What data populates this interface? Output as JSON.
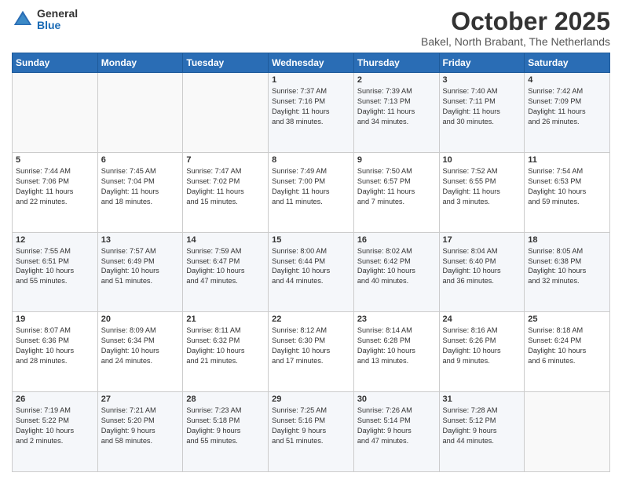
{
  "header": {
    "logo_general": "General",
    "logo_blue": "Blue",
    "month": "October 2025",
    "location": "Bakel, North Brabant, The Netherlands"
  },
  "days_of_week": [
    "Sunday",
    "Monday",
    "Tuesday",
    "Wednesday",
    "Thursday",
    "Friday",
    "Saturday"
  ],
  "weeks": [
    [
      {
        "day": "",
        "info": ""
      },
      {
        "day": "",
        "info": ""
      },
      {
        "day": "",
        "info": ""
      },
      {
        "day": "1",
        "info": "Sunrise: 7:37 AM\nSunset: 7:16 PM\nDaylight: 11 hours\nand 38 minutes."
      },
      {
        "day": "2",
        "info": "Sunrise: 7:39 AM\nSunset: 7:13 PM\nDaylight: 11 hours\nand 34 minutes."
      },
      {
        "day": "3",
        "info": "Sunrise: 7:40 AM\nSunset: 7:11 PM\nDaylight: 11 hours\nand 30 minutes."
      },
      {
        "day": "4",
        "info": "Sunrise: 7:42 AM\nSunset: 7:09 PM\nDaylight: 11 hours\nand 26 minutes."
      }
    ],
    [
      {
        "day": "5",
        "info": "Sunrise: 7:44 AM\nSunset: 7:06 PM\nDaylight: 11 hours\nand 22 minutes."
      },
      {
        "day": "6",
        "info": "Sunrise: 7:45 AM\nSunset: 7:04 PM\nDaylight: 11 hours\nand 18 minutes."
      },
      {
        "day": "7",
        "info": "Sunrise: 7:47 AM\nSunset: 7:02 PM\nDaylight: 11 hours\nand 15 minutes."
      },
      {
        "day": "8",
        "info": "Sunrise: 7:49 AM\nSunset: 7:00 PM\nDaylight: 11 hours\nand 11 minutes."
      },
      {
        "day": "9",
        "info": "Sunrise: 7:50 AM\nSunset: 6:57 PM\nDaylight: 11 hours\nand 7 minutes."
      },
      {
        "day": "10",
        "info": "Sunrise: 7:52 AM\nSunset: 6:55 PM\nDaylight: 11 hours\nand 3 minutes."
      },
      {
        "day": "11",
        "info": "Sunrise: 7:54 AM\nSunset: 6:53 PM\nDaylight: 10 hours\nand 59 minutes."
      }
    ],
    [
      {
        "day": "12",
        "info": "Sunrise: 7:55 AM\nSunset: 6:51 PM\nDaylight: 10 hours\nand 55 minutes."
      },
      {
        "day": "13",
        "info": "Sunrise: 7:57 AM\nSunset: 6:49 PM\nDaylight: 10 hours\nand 51 minutes."
      },
      {
        "day": "14",
        "info": "Sunrise: 7:59 AM\nSunset: 6:47 PM\nDaylight: 10 hours\nand 47 minutes."
      },
      {
        "day": "15",
        "info": "Sunrise: 8:00 AM\nSunset: 6:44 PM\nDaylight: 10 hours\nand 44 minutes."
      },
      {
        "day": "16",
        "info": "Sunrise: 8:02 AM\nSunset: 6:42 PM\nDaylight: 10 hours\nand 40 minutes."
      },
      {
        "day": "17",
        "info": "Sunrise: 8:04 AM\nSunset: 6:40 PM\nDaylight: 10 hours\nand 36 minutes."
      },
      {
        "day": "18",
        "info": "Sunrise: 8:05 AM\nSunset: 6:38 PM\nDaylight: 10 hours\nand 32 minutes."
      }
    ],
    [
      {
        "day": "19",
        "info": "Sunrise: 8:07 AM\nSunset: 6:36 PM\nDaylight: 10 hours\nand 28 minutes."
      },
      {
        "day": "20",
        "info": "Sunrise: 8:09 AM\nSunset: 6:34 PM\nDaylight: 10 hours\nand 24 minutes."
      },
      {
        "day": "21",
        "info": "Sunrise: 8:11 AM\nSunset: 6:32 PM\nDaylight: 10 hours\nand 21 minutes."
      },
      {
        "day": "22",
        "info": "Sunrise: 8:12 AM\nSunset: 6:30 PM\nDaylight: 10 hours\nand 17 minutes."
      },
      {
        "day": "23",
        "info": "Sunrise: 8:14 AM\nSunset: 6:28 PM\nDaylight: 10 hours\nand 13 minutes."
      },
      {
        "day": "24",
        "info": "Sunrise: 8:16 AM\nSunset: 6:26 PM\nDaylight: 10 hours\nand 9 minutes."
      },
      {
        "day": "25",
        "info": "Sunrise: 8:18 AM\nSunset: 6:24 PM\nDaylight: 10 hours\nand 6 minutes."
      }
    ],
    [
      {
        "day": "26",
        "info": "Sunrise: 7:19 AM\nSunset: 5:22 PM\nDaylight: 10 hours\nand 2 minutes."
      },
      {
        "day": "27",
        "info": "Sunrise: 7:21 AM\nSunset: 5:20 PM\nDaylight: 9 hours\nand 58 minutes."
      },
      {
        "day": "28",
        "info": "Sunrise: 7:23 AM\nSunset: 5:18 PM\nDaylight: 9 hours\nand 55 minutes."
      },
      {
        "day": "29",
        "info": "Sunrise: 7:25 AM\nSunset: 5:16 PM\nDaylight: 9 hours\nand 51 minutes."
      },
      {
        "day": "30",
        "info": "Sunrise: 7:26 AM\nSunset: 5:14 PM\nDaylight: 9 hours\nand 47 minutes."
      },
      {
        "day": "31",
        "info": "Sunrise: 7:28 AM\nSunset: 5:12 PM\nDaylight: 9 hours\nand 44 minutes."
      },
      {
        "day": "",
        "info": ""
      }
    ]
  ]
}
